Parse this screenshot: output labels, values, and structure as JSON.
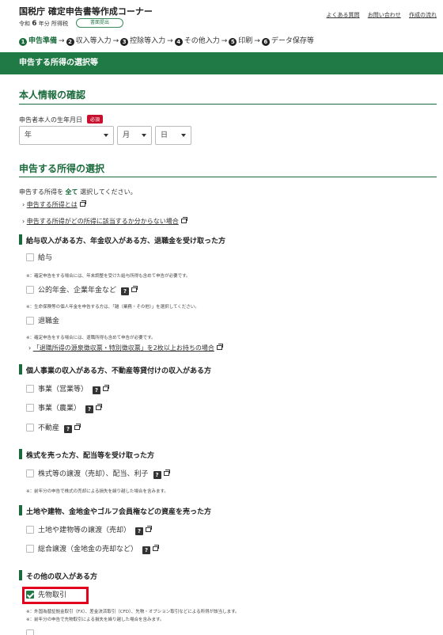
{
  "header": {
    "title": "国税庁 確定申告書等作成コーナー",
    "era_prefix": "令和",
    "year": "6",
    "year_suffix": "年分",
    "tax_type": "所得税",
    "paper_button": "書面提出",
    "links": [
      "よくある質問",
      "お問い合わせ",
      "作成の流れ"
    ]
  },
  "steps": [
    {
      "num": "1",
      "label": "申告準備",
      "current": true
    },
    {
      "num": "2",
      "label": "収入等入力"
    },
    {
      "num": "3",
      "label": "控除等入力"
    },
    {
      "num": "4",
      "label": "その他入力"
    },
    {
      "num": "5",
      "label": "印刷"
    },
    {
      "num": "6",
      "label": "データ保存等"
    }
  ],
  "arrow": "→",
  "band_title": "申告する所得の選択等",
  "personal": {
    "title": "本人情報の確認",
    "birth_label": "申告者本人の生年月日",
    "required": "必須",
    "year_select": "年",
    "month_select": "月",
    "day_select": "日"
  },
  "income": {
    "title": "申告する所得の選択",
    "instr_pre": "申告する所得を",
    "instr_bold": "全て",
    "instr_post": "選択してください。",
    "link1": "申告する所得とは",
    "link2": "申告する所得がどの所得に該当するか分からない場合",
    "chevron": "›"
  },
  "groups": {
    "g1": {
      "title": "給与収入がある方、年金収入がある方、退職金を受け取った方",
      "salary": "給与",
      "salary_note": "※：確定申告をする場合には、年末調整を受けた給与所得も含めて申告が必要です。",
      "pension": "公的年金、企業年金など",
      "pension_note": "※：生命保険等の個人年金を申告する方は、「雑（業務・その他）」を選択してください。",
      "retire": "退職金",
      "retire_note": "※：確定申告をする場合には、退職所得も含めて申告が必要です。",
      "retire_link": "「退職所得の源泉徴収票・特別徴収票」を2枚以上お持ちの場合"
    },
    "g2": {
      "title": "個人事業の収入がある方、不動産等貸付けの収入がある方",
      "business": "事業（営業等）",
      "farm": "事業（農業）",
      "realestate": "不動産"
    },
    "g3": {
      "title": "株式を売った方、配当等を受け取った方",
      "stock": "株式等の譲渡（売却）、配当、利子",
      "stock_note": "※：前年分の申告で株式の売却による損失を繰り越した場合を含みます。"
    },
    "g4": {
      "title": "土地や建物、金地金やゴルフ会員権などの資産を売った方",
      "land": "土地や建物等の譲渡（売却）",
      "general": "総合譲渡（金地金の売却など）"
    },
    "g5": {
      "title": "その他の収入がある方",
      "futures": "先物取引",
      "futures_checked": true,
      "futures_note1": "※：外国為替証拠金取引（FX）、差金決済取引（CFD）、先物・オプション取引などによる所得が該当します。",
      "futures_note2": "※：前年分の申告で先物取引による損失を繰り越した場合を含みます。"
    }
  },
  "help_icon_label": "?",
  "colors": {
    "primary": "#1f7a45",
    "required": "#c8102e",
    "highlight": "#e1001e"
  }
}
